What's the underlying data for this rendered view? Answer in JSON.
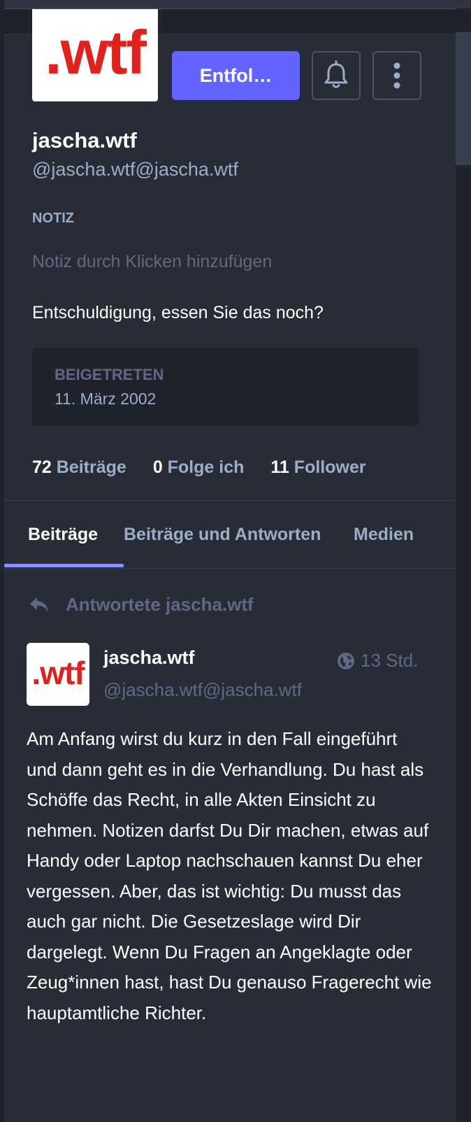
{
  "profile": {
    "avatar_text": ".wtf",
    "follow_button_label": "Entfol…",
    "display_name": "jascha.wtf",
    "account": "@jascha.wtf@jascha.wtf",
    "note_label": "NOTIZ",
    "note_placeholder": "Notiz durch Klicken hinzufügen",
    "bio": "Entschuldigung, essen Sie das noch?",
    "joined_label": "BEIGETRETEN",
    "joined_date": "11. März 2002"
  },
  "stats": [
    {
      "count": "72",
      "label": "Beiträge"
    },
    {
      "count": "0",
      "label": "Folge ich"
    },
    {
      "count": "11",
      "label": "Follower"
    }
  ],
  "tabs": [
    {
      "label": "Beiträge",
      "active": true
    },
    {
      "label": "Beiträge und Antworten",
      "active": false
    },
    {
      "label": "Medien",
      "active": false
    }
  ],
  "post": {
    "reply_label": "Antwortete jascha.wtf",
    "avatar_text": ".wtf",
    "author_name": "jascha.wtf",
    "author_account": "@jascha.wtf@jascha.wtf",
    "time": "13 Std.",
    "visibility_icon": "globe-icon",
    "content": "Am Anfang wirst du kurz in den Fall eingeführt und dann geht es in die Verhandlung. Du hast als Schöffe das Recht, in alle Akten Einsicht zu nehmen. Notizen darfst Du Dir machen, etwas auf Handy oder Laptop nachschauen kannst Du eher vergessen. Aber, das ist wichtig: Du musst das auch gar nicht. Die Gesetzeslage wird Dir dargelegt. Wenn Du Fragen an Angeklagte oder Zeug*innen hast, hast Du genauso Fragerecht wie hauptamtliche Richter."
  },
  "colors": {
    "background": "#282c37",
    "accent": "#6364ff",
    "secondary_text": "#9baec8",
    "muted_text": "#606984",
    "logo_red": "#e2201c"
  }
}
